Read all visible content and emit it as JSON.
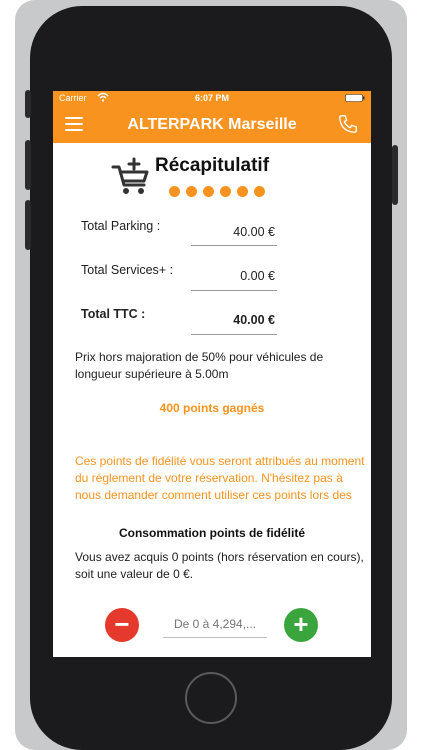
{
  "status_bar": {
    "carrier": "Carrier",
    "time": "6:07 PM"
  },
  "nav": {
    "title": "ALTERPARK Marseille"
  },
  "heading": {
    "title": "Récapitulatif",
    "step_dots": 6
  },
  "summary": [
    {
      "label": "Total Parking :",
      "value": "40.00 €"
    },
    {
      "label": "Total Services+ :",
      "value": "0.00 €"
    },
    {
      "label": "Total TTC :",
      "value": "40.00 €"
    }
  ],
  "note": "Prix hors majoration de 50% pour véhicules de longueur supérieure à 5.00m",
  "points_earned": "400 points gagnés",
  "fidelity_info": "Ces points de fidélité vous seront attribués au moment du réglement de votre réservation. N'hésitez pas à nous demander comment utiliser ces points lors des",
  "consumption": {
    "title": "Consommation points de fidélité",
    "text": "Vous avez acquis 0 points (hors réservation en cours), soit une valeur de 0 €.",
    "input_placeholder": "De 0 à 4,294,..."
  },
  "colors": {
    "accent": "#f7931e",
    "minus": "#e5392d",
    "plus": "#3aa53d"
  },
  "icons": [
    "wifi-icon",
    "battery-icon",
    "menu-icon",
    "phone-icon",
    "cart-add-icon",
    "minus-icon",
    "plus-icon"
  ]
}
